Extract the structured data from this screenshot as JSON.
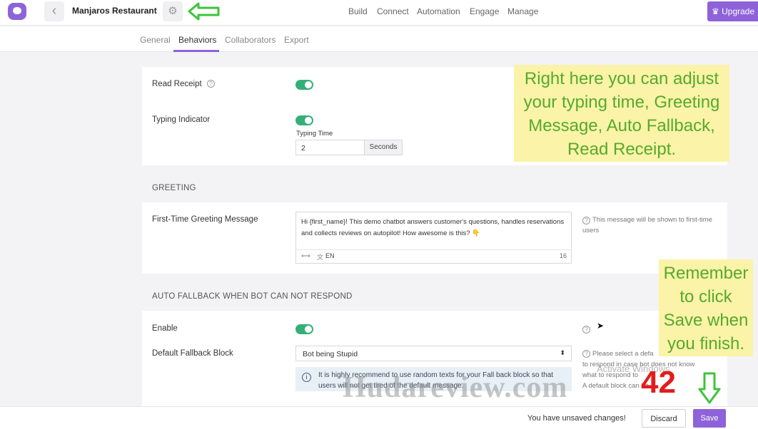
{
  "header": {
    "title": "Manjaros Restaurant",
    "nav": [
      "Build",
      "Connect",
      "Automation",
      "Engage",
      "Manage"
    ],
    "upgrade_label": "Upgrade"
  },
  "tabs": [
    "General",
    "Behaviors",
    "Collaborators",
    "Export"
  ],
  "behaviors": {
    "read_receipt_label": "Read Receipt",
    "typing_indicator_label": "Typing Indicator",
    "typing_time_label": "Typing Time",
    "typing_time_value": "2",
    "seconds_label": "Seconds"
  },
  "greeting": {
    "section_title": "GREETING",
    "label": "First-Time Greeting Message",
    "message": "Hi {first_name}! This demo chatbot answers customer's questions, handles reservations and collects reviews on autopilot! How awesome is this? 👇",
    "lang": "EN",
    "char_count": "16",
    "hint": "This message will be shown to first-time users"
  },
  "fallback": {
    "section_title": "AUTO FALLBACK WHEN BOT CAN NOT RESPOND",
    "enable_label": "Enable",
    "block_label": "Default Fallback Block",
    "block_value": "Bot being Stupid",
    "hint_lines": [
      "Please select a defa",
      "to respond in case bot does not know",
      "what to respond to",
      "A default block can be"
    ],
    "alert": "It is highly recommend to use random texts for your Fall back block so that users will not get tired of the default message."
  },
  "annotations": {
    "note1": [
      "Right here you can adjust",
      "your typing time, Greeting",
      "Message, Auto Fallback,",
      "Read Receipt."
    ],
    "note2": [
      "Remember",
      "to click",
      "Save when",
      "you finish."
    ],
    "watermark": "Hudareview.com",
    "red_number": "42",
    "activate_windows": "Activate Windows"
  },
  "footer": {
    "unsaved": "You have unsaved changes!",
    "discard": "Discard",
    "save": "Save"
  },
  "colors": {
    "accent": "#8e63d9",
    "toggle_on": "#33b07a",
    "note_bg": "#fbf3a7",
    "note_text": "#55aa2f",
    "annotation_arrow": "#3cc43a"
  }
}
